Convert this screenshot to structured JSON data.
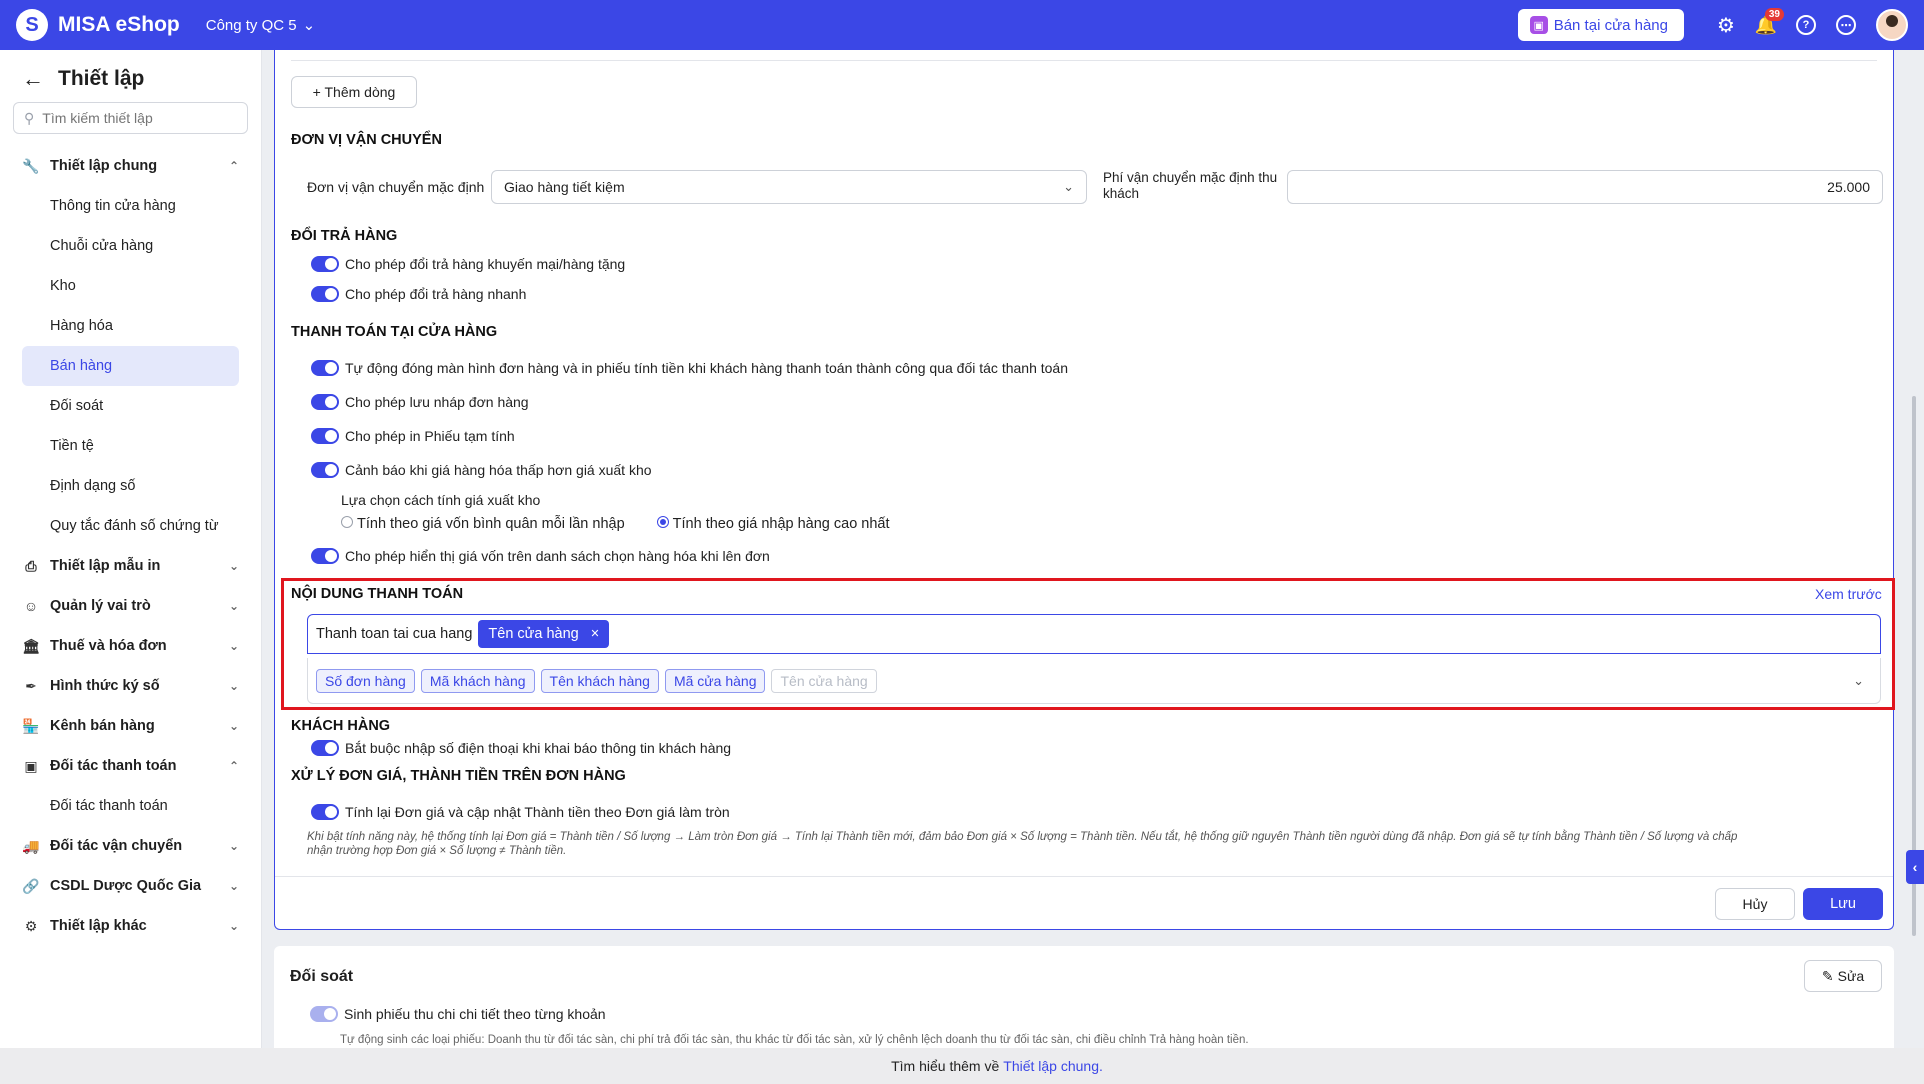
{
  "topbar": {
    "brand": "MISA eShop",
    "company": "Công ty QC 5",
    "sell_button": "Bán tại cửa hàng",
    "notification_count": "39"
  },
  "sidebar": {
    "title": "Thiết lập",
    "search_placeholder": "Tìm kiếm thiết lập",
    "groups": [
      {
        "label": "Thiết lập chung",
        "items": [
          "Thông tin cửa hàng",
          "Chuỗi cửa hàng",
          "Kho",
          "Hàng hóa",
          "Bán hàng",
          "Đối soát",
          "Tiền tệ",
          "Định dạng số",
          "Quy tắc đánh số chứng từ"
        ]
      },
      {
        "label": "Thiết lập mẫu in"
      },
      {
        "label": "Quản lý vai trò"
      },
      {
        "label": "Thuế và hóa đơn"
      },
      {
        "label": "Hình thức ký số"
      },
      {
        "label": "Kênh bán hàng"
      },
      {
        "label": "Đối tác thanh toán",
        "items": [
          "Đối tác thanh toán"
        ]
      },
      {
        "label": "Đối tác vận chuyển"
      },
      {
        "label": "CSDL Dược Quốc Gia"
      },
      {
        "label": "Thiết lập khác"
      }
    ]
  },
  "main": {
    "add_row": "+ Thêm dòng",
    "shipping": {
      "title": "ĐƠN VỊ VẬN CHUYỂN",
      "default_label": "Đơn vị vận chuyển mặc định",
      "default_value": "Giao hàng tiết kiệm",
      "fee_label_1": "Phí vận chuyển mặc định thu",
      "fee_label_2": "khách",
      "fee_value": "25.000"
    },
    "returns": {
      "title": "ĐỔI TRẢ HÀNG",
      "opt1": "Cho phép đổi trả hàng khuyến mại/hàng tặng",
      "opt2": "Cho phép đổi trả hàng nhanh"
    },
    "store_payment": {
      "title": "THANH TOÁN TẠI CỬA HÀNG",
      "opt1": "Tự động đóng màn hình đơn hàng và in phiếu tính tiền khi khách hàng thanh toán thành công qua đối tác thanh toán",
      "opt2": "Cho phép lưu nháp đơn hàng",
      "opt3": "Cho phép in Phiếu tạm tính",
      "opt4": "Cảnh báo khi giá hàng hóa thấp hơn giá xuất kho",
      "price_method_label": "Lựa chọn cách tính giá xuất kho",
      "radio1": "Tính theo giá vốn bình quân mỗi lần nhập",
      "radio2": "Tính theo giá nhập hàng cao nhất",
      "opt5": "Cho phép hiển thị giá vốn trên danh sách chọn hàng hóa khi lên đơn"
    },
    "payment_content": {
      "title": "NỘI DUNG THANH TOÁN",
      "preview": "Xem trước",
      "prefix_text": "Thanh toan tai cua hang",
      "selected_chip": "Tên cửa hàng",
      "tags": [
        "Số đơn hàng",
        "Mã khách hàng",
        "Tên khách hàng",
        "Mã cửa hàng"
      ],
      "disabled_tag": "Tên cửa hàng"
    },
    "customer": {
      "title": "KHÁCH HÀNG",
      "opt1": "Bắt buộc nhập số điện thoại khi khai báo thông tin khách hàng"
    },
    "pricing": {
      "title": "XỬ LÝ ĐƠN GIÁ, THÀNH TIỀN TRÊN ĐƠN HÀNG",
      "opt1": "Tính lại Đơn giá và cập nhật Thành tiền theo Đơn giá làm tròn",
      "note_line1": "Khi bật tính năng này, hệ thống tính lại Đơn giá = Thành tiền / Số lượng → Làm tròn Đơn giá → Tính lại Thành tiền mới, đảm bảo Đơn giá × Số lượng = Thành tiền. Nếu tắt, hệ thống giữ nguyên Thành tiền người dùng đã nhập. Đơn giá sẽ tự tính bằng Thành tiền / Số lượng và chấp",
      "note_line2": "nhận trường hợp Đơn giá × Số lượng ≠ Thành tiền."
    },
    "cancel": "Hủy",
    "save": "Lưu"
  },
  "reconcile": {
    "title": "Đối soát",
    "edit": "Sửa",
    "opt1": "Sinh phiếu thu chi chi tiết theo từng khoản",
    "note": "Tự động sinh các loại phiếu: Doanh thu từ đối tác sàn, chi phí trả đối tác sàn, thu khác từ đối tác sàn, xử lý chênh lệch doanh thu từ đối tác sàn, chi điều chỉnh Trả hàng hoàn tiền."
  },
  "footer": {
    "text": "Tìm hiểu thêm về",
    "link": "Thiết lập chung."
  }
}
